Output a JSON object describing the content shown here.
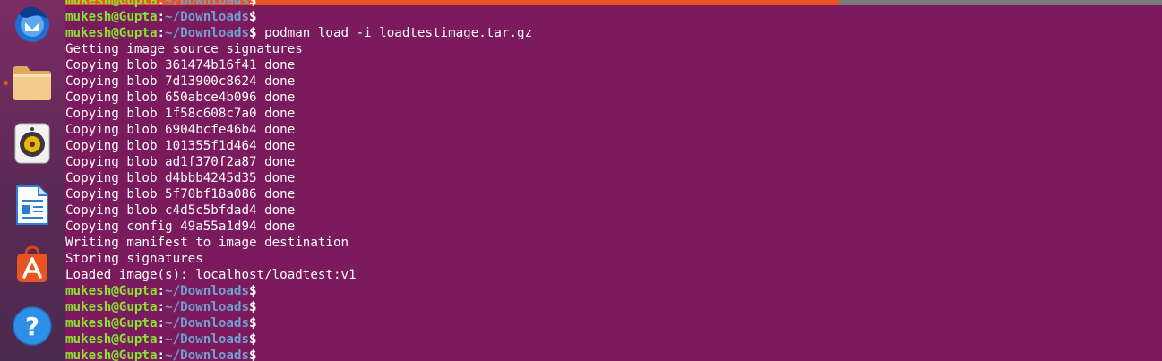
{
  "dock": {
    "items": [
      {
        "name": "thunderbird-icon",
        "running": false
      },
      {
        "name": "files-icon",
        "running": true
      },
      {
        "name": "rhythmbox-icon",
        "running": false
      },
      {
        "name": "libreoffice-writer-icon",
        "running": false
      },
      {
        "name": "ubuntu-software-icon",
        "running": false
      },
      {
        "name": "help-icon",
        "running": false
      }
    ],
    "help_glyph": "?"
  },
  "terminal": {
    "prompt": {
      "user": "mukesh@Gupta",
      "colon": ":",
      "path": "~/Downloads",
      "symbol": "$"
    },
    "command": " podman load -i loadtestimage.tar.gz",
    "output": [
      "Getting image source signatures",
      "Copying blob 361474b16f41 done",
      "Copying blob 7d13900c8624 done",
      "Copying blob 650abce4b096 done",
      "Copying blob 1f58c608c7a0 done",
      "Copying blob 6904bcfe46b4 done",
      "Copying blob 101355f1d464 done",
      "Copying blob ad1f370f2a87 done",
      "Copying blob d4bbb4245d35 done",
      "Copying blob 5f70bf18a086 done",
      "Copying blob c4d5c5bfdad4 done",
      "Copying config 49a55a1d94 done",
      "Writing manifest to image destination",
      "Storing signatures",
      "Loaded image(s): localhost/loadtest:v1"
    ]
  },
  "colors": {
    "background": "#7b1a5c",
    "user": "#8ae234",
    "path": "#729fcf",
    "accent": "#e95420"
  }
}
